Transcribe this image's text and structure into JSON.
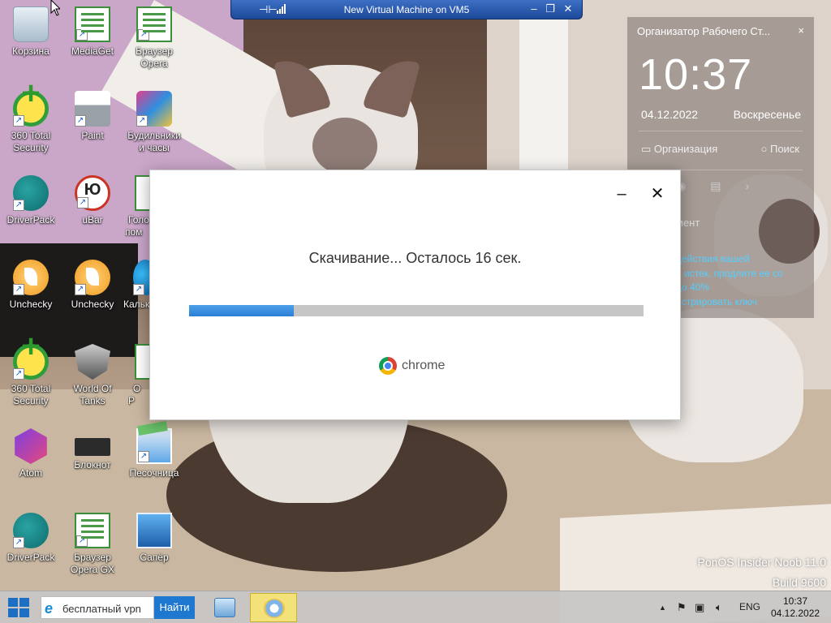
{
  "desktop_icons": [
    {
      "label": "Корзина",
      "icon": "recycle-bin-icon"
    },
    {
      "label": "MediaGet",
      "icon": "mediaget-icon"
    },
    {
      "label": "Браузер Opera",
      "icon": "opera-browser-icon"
    },
    {
      "label": "360 Total Security",
      "icon": "360-security-icon"
    },
    {
      "label": "Paint",
      "icon": "paint-icon"
    },
    {
      "label": "Будильники и часы",
      "icon": "alarms-clock-icon"
    },
    {
      "label": "DriverPack",
      "icon": "driverpack-icon"
    },
    {
      "label": "uBar",
      "icon": "ubar-icon"
    },
    {
      "label": "Голо пом",
      "icon": "voice-assistant-icon"
    },
    {
      "label": "Unchecky",
      "icon": "unchecky-icon"
    },
    {
      "label": "Unchecky",
      "icon": "unchecky-icon"
    },
    {
      "label": "Кальк",
      "icon": "calculator-icon"
    },
    {
      "label": "360 Total Security",
      "icon": "360-security-icon"
    },
    {
      "label": "World Of Tanks",
      "icon": "world-of-tanks-icon"
    },
    {
      "label": "O P",
      "icon": "document-icon"
    },
    {
      "label": "Atom",
      "icon": "atom-icon"
    },
    {
      "label": "Блокнот",
      "icon": "notepad-icon"
    },
    {
      "label": "Песочница",
      "icon": "sandbox-icon"
    },
    {
      "label": "DriverPack",
      "icon": "driverpack-icon"
    },
    {
      "label": "Браузер Opera GX",
      "icon": "opera-gx-icon"
    },
    {
      "label": "Сапёр",
      "icon": "minesweeper-icon"
    }
  ],
  "vm_bar": {
    "title": "New Virtual Machine on VM5",
    "minimize": "–",
    "restore": "❐",
    "close": "✕"
  },
  "gadget": {
    "title": "Организатор Рабочего Ст...",
    "close": "×",
    "time": "10:37",
    "date": "04.12.2022",
    "weekday": "Воскресенье",
    "organization": "Организация",
    "search": "Поиск",
    "partial_label": "мент",
    "notice_lines": [
      "действия вашей",
      "и истек, продлите ее со",
      "до 40%",
      "истрировать ключ"
    ]
  },
  "dialog": {
    "status": "Скачивание... Осталось 16 сек.",
    "progress": 0.23,
    "brand": "chrome",
    "minimize": "–",
    "close": "✕"
  },
  "watermark": {
    "line1": "PonOS Insider Noob 11.0",
    "line2": "Build 9600"
  },
  "taskbar": {
    "search_value": "бесплатный vpn",
    "go_label": "Найти",
    "language": "ENG",
    "time": "10:37",
    "date": "04.12.2022"
  },
  "colors": {
    "accent_blue": "#2a7fd6",
    "vm_bar": "#2a5bb0",
    "gadget_link": "#55d0ff"
  }
}
